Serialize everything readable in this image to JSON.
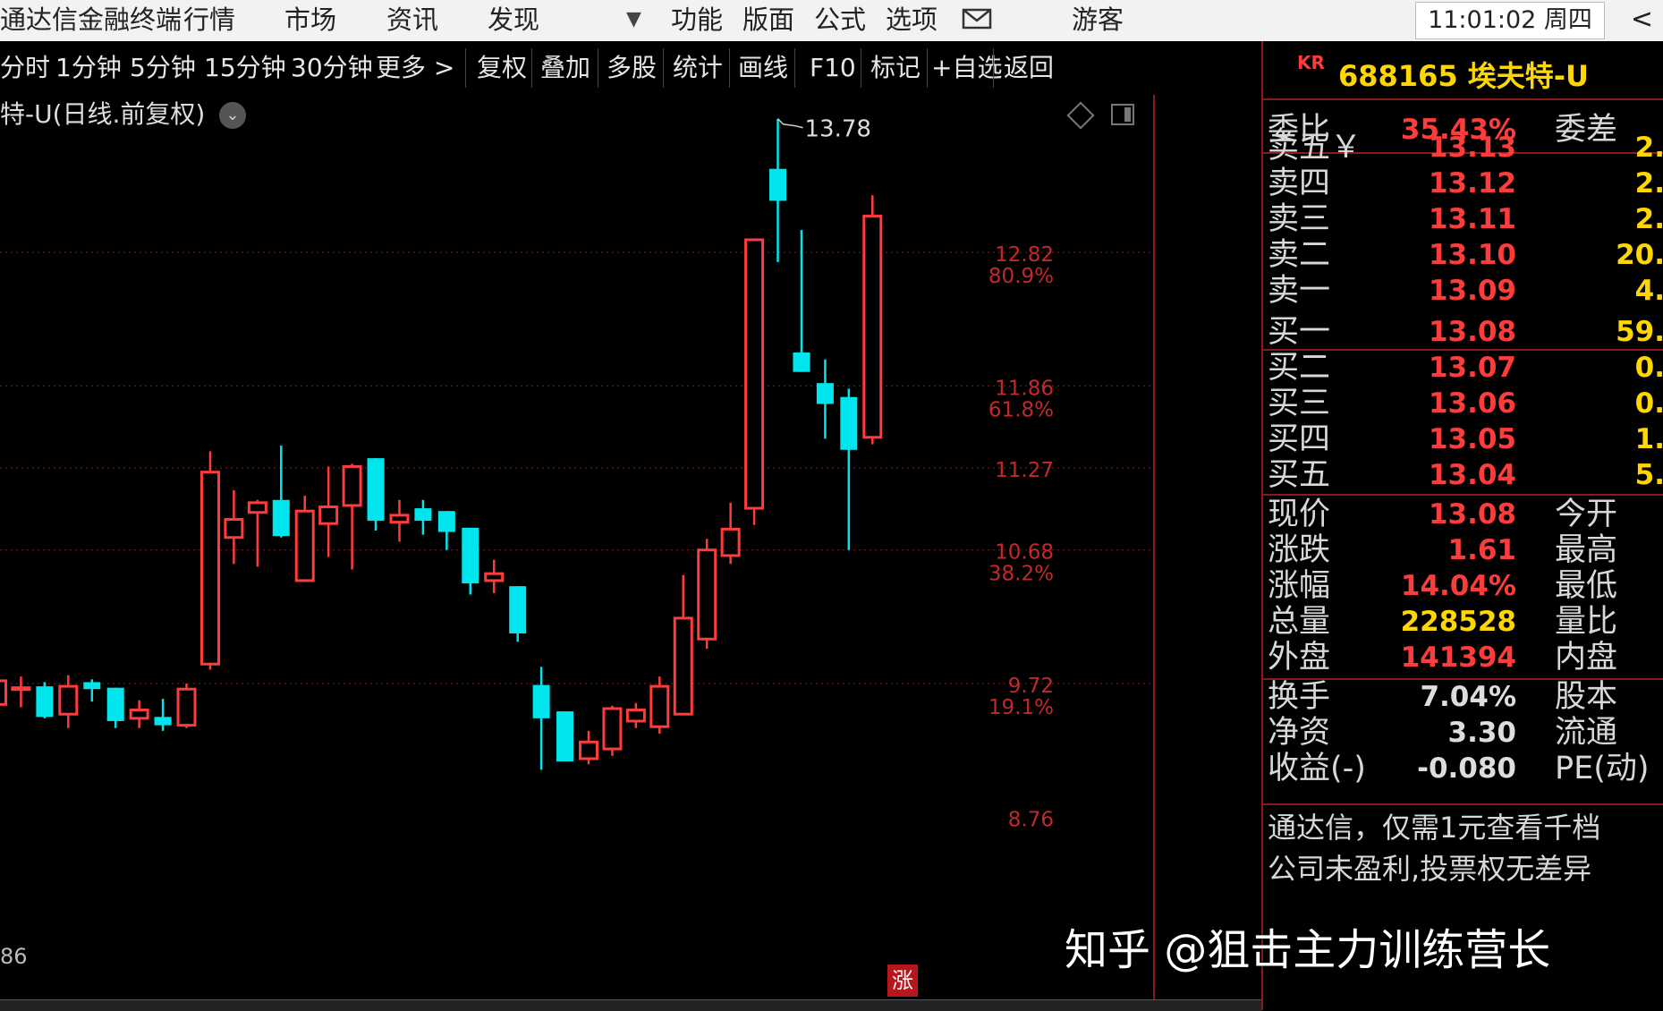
{
  "menubar": {
    "app_title": "通达信金融终端",
    "items": [
      "行情",
      "市场",
      "资讯",
      "发现"
    ],
    "dropdown_icon": "▼",
    "items_right": [
      "功能",
      "版面",
      "公式",
      "选项"
    ],
    "mail_icon": "mail-icon",
    "user": "游客",
    "clock": "11:01:02 周四",
    "back_arrow": "<"
  },
  "toolbar": {
    "periods": [
      "分时",
      "1分钟",
      "5分钟",
      "15分钟",
      "30分钟",
      "更多 >"
    ],
    "actions": [
      "复权",
      "叠加",
      "多股",
      "统计",
      "画线",
      "F10",
      "标记",
      "+自选",
      "返回"
    ]
  },
  "chart": {
    "title": "特-U(日线.前复权)",
    "bottom_left_label": "86",
    "zhang_badge": "涨",
    "high_annotation": "13.78"
  },
  "chart_data": {
    "type": "candlestick",
    "title": "特-U(日线.前复权)",
    "y_axis_labels": [
      {
        "value": 12.82,
        "label": "12.82",
        "pct": "80.9%"
      },
      {
        "value": 11.86,
        "label": "11.86",
        "pct": "61.8%"
      },
      {
        "value": 11.27,
        "label": "11.27",
        "pct": ""
      },
      {
        "value": 10.68,
        "label": "10.68",
        "pct": "38.2%"
      },
      {
        "value": 9.72,
        "label": "9.72",
        "pct": "19.1%"
      },
      {
        "value": 8.76,
        "label": "8.76",
        "pct": ""
      }
    ],
    "ylim": [
      8.6,
      13.98
    ],
    "grid_lines": [
      12.82,
      11.86,
      11.27,
      10.68,
      9.72
    ],
    "candles": [
      {
        "o": 9.57,
        "h": 9.75,
        "l": 9.5,
        "c": 9.74
      },
      {
        "o": 9.68,
        "h": 9.77,
        "l": 9.55,
        "c": 9.69
      },
      {
        "o": 9.7,
        "h": 9.73,
        "l": 9.47,
        "c": 9.48
      },
      {
        "o": 9.5,
        "h": 9.78,
        "l": 9.4,
        "c": 9.7
      },
      {
        "o": 9.73,
        "h": 9.75,
        "l": 9.59,
        "c": 9.68
      },
      {
        "o": 9.69,
        "h": 9.69,
        "l": 9.4,
        "c": 9.45
      },
      {
        "o": 9.47,
        "h": 9.6,
        "l": 9.4,
        "c": 9.53
      },
      {
        "o": 9.48,
        "h": 9.61,
        "l": 9.38,
        "c": 9.42
      },
      {
        "o": 9.42,
        "h": 9.72,
        "l": 9.4,
        "c": 9.68
      },
      {
        "o": 9.86,
        "h": 11.39,
        "l": 9.82,
        "c": 11.24
      },
      {
        "o": 10.77,
        "h": 11.11,
        "l": 10.58,
        "c": 10.9
      },
      {
        "o": 10.95,
        "h": 11.04,
        "l": 10.56,
        "c": 11.02
      },
      {
        "o": 11.04,
        "h": 11.43,
        "l": 10.77,
        "c": 10.78
      },
      {
        "o": 10.46,
        "h": 11.07,
        "l": 10.46,
        "c": 10.96
      },
      {
        "o": 10.87,
        "h": 11.28,
        "l": 10.63,
        "c": 10.99
      },
      {
        "o": 11.0,
        "h": 11.3,
        "l": 10.54,
        "c": 11.28
      },
      {
        "o": 11.34,
        "h": 11.34,
        "l": 10.82,
        "c": 10.89
      },
      {
        "o": 10.88,
        "h": 11.04,
        "l": 10.74,
        "c": 10.93
      },
      {
        "o": 10.98,
        "h": 11.04,
        "l": 10.79,
        "c": 10.89
      },
      {
        "o": 10.96,
        "h": 10.96,
        "l": 10.68,
        "c": 10.81
      },
      {
        "o": 10.84,
        "h": 10.84,
        "l": 10.36,
        "c": 10.44
      },
      {
        "o": 10.46,
        "h": 10.61,
        "l": 10.37,
        "c": 10.51
      },
      {
        "o": 10.42,
        "h": 10.42,
        "l": 10.02,
        "c": 10.08
      },
      {
        "o": 9.71,
        "h": 9.84,
        "l": 9.1,
        "c": 9.47
      },
      {
        "o": 9.52,
        "h": 9.52,
        "l": 9.16,
        "c": 9.16
      },
      {
        "o": 9.18,
        "h": 9.38,
        "l": 9.14,
        "c": 9.3
      },
      {
        "o": 9.25,
        "h": 9.56,
        "l": 9.2,
        "c": 9.54
      },
      {
        "o": 9.45,
        "h": 9.58,
        "l": 9.4,
        "c": 9.53
      },
      {
        "o": 9.41,
        "h": 9.77,
        "l": 9.36,
        "c": 9.7
      },
      {
        "o": 9.5,
        "h": 10.5,
        "l": 9.5,
        "c": 10.19
      },
      {
        "o": 10.04,
        "h": 10.76,
        "l": 9.97,
        "c": 10.68
      },
      {
        "o": 10.64,
        "h": 11.02,
        "l": 10.58,
        "c": 10.83
      },
      {
        "o": 10.98,
        "h": 12.92,
        "l": 10.86,
        "c": 12.91
      },
      {
        "o": 13.42,
        "h": 13.78,
        "l": 12.75,
        "c": 13.19
      },
      {
        "o": 12.1,
        "h": 12.98,
        "l": 11.96,
        "c": 11.96
      },
      {
        "o": 11.88,
        "h": 12.05,
        "l": 11.48,
        "c": 11.73
      },
      {
        "o": 11.78,
        "h": 11.84,
        "l": 10.68,
        "c": 11.4
      },
      {
        "o": 11.49,
        "h": 13.23,
        "l": 11.44,
        "c": 13.08
      }
    ]
  },
  "panel": {
    "kr": "KR",
    "stock": "688165 埃夫特-U",
    "weibi": {
      "label": "委比",
      "value": "35.43%",
      "label2": "委差"
    },
    "asks": [
      {
        "label": "卖五",
        "suffix": "￥",
        "price": "13.13",
        "vol": "2."
      },
      {
        "label": "卖四",
        "suffix": "",
        "price": "13.12",
        "vol": "2."
      },
      {
        "label": "卖三",
        "suffix": "",
        "price": "13.11",
        "vol": "2."
      },
      {
        "label": "卖二",
        "suffix": "",
        "price": "13.10",
        "vol": "20."
      },
      {
        "label": "卖一",
        "suffix": "",
        "price": "13.09",
        "vol": "4."
      }
    ],
    "bids": [
      {
        "label": "买一",
        "price": "13.08",
        "vol": "59."
      },
      {
        "label": "买二",
        "price": "13.07",
        "vol": "0."
      },
      {
        "label": "买三",
        "price": "13.06",
        "vol": "0."
      },
      {
        "label": "买四",
        "price": "13.05",
        "vol": "1."
      },
      {
        "label": "买五",
        "price": "13.04",
        "vol": "5."
      }
    ],
    "quote": [
      {
        "label": "现价",
        "value": "13.08",
        "color": "#ff3c3c",
        "label2": "今开"
      },
      {
        "label": "涨跌",
        "value": "1.61",
        "color": "#ff3c3c",
        "label2": "最高"
      },
      {
        "label": "涨幅",
        "value": "14.04%",
        "color": "#ff3c3c",
        "label2": "最低"
      },
      {
        "label": "总量",
        "value": "228528",
        "color": "#ffd700",
        "label2": "量比"
      },
      {
        "label": "外盘",
        "value": "141394",
        "color": "#ff3c3c",
        "label2": "内盘"
      }
    ],
    "fundamentals": [
      {
        "label": "换手",
        "value": "7.04%",
        "color": "#dddddd",
        "label2": "股本"
      },
      {
        "label": "净资",
        "value": "3.30",
        "color": "#dddddd",
        "label2": "流通"
      },
      {
        "label": "收益(-)",
        "value": "-0.080",
        "color": "#dddddd",
        "label2": "PE(动)"
      }
    ],
    "notes": [
      "通达信，仅需1元查看千档",
      "公司未盈利,投票权无差异"
    ]
  },
  "watermark": "知乎 @狙击主力训练营长",
  "colors": {
    "up": "#ff3c3c",
    "down": "#00e5ee",
    "grid": "#8b1a1a",
    "axis_label": "#c4282a"
  }
}
